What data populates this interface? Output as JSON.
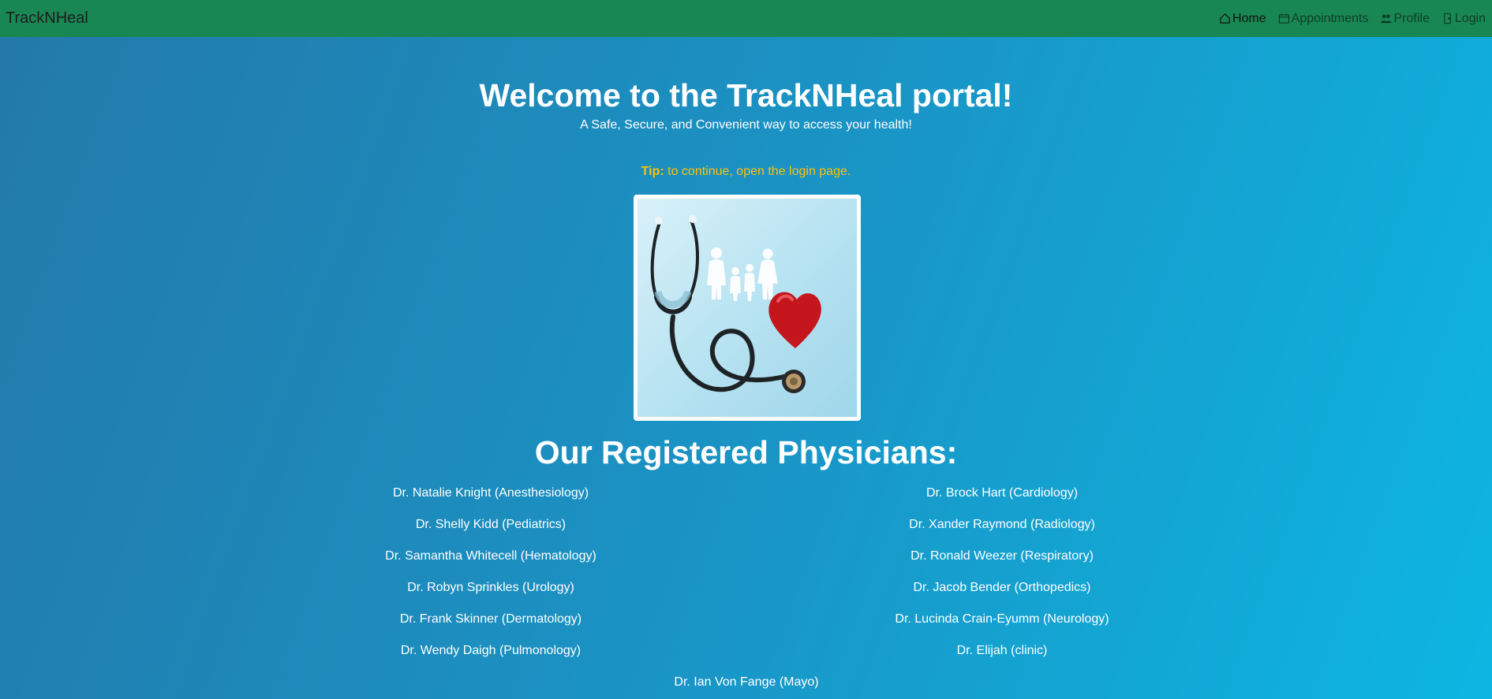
{
  "navbar": {
    "brand": "TrackNHeal",
    "items": [
      {
        "label": "Home",
        "icon": "home-icon"
      },
      {
        "label": "Appointments",
        "icon": "calendar-icon"
      },
      {
        "label": "Profile",
        "icon": "people-icon"
      },
      {
        "label": "Login",
        "icon": "door-icon"
      }
    ]
  },
  "hero": {
    "title": "Welcome to the TrackNHeal portal!",
    "subtitle": "A Safe, Secure, and Convenient way to access your health!",
    "tip_label": "Tip:",
    "tip_text": " to continue, open the login page."
  },
  "physicians": {
    "title": "Our Registered Physicians:",
    "left": [
      "Dr. Natalie Knight (Anesthesiology)",
      "Dr. Shelly Kidd (Pediatrics)",
      "Dr. Samantha Whitecell (Hematology)",
      "Dr. Robyn Sprinkles (Urology)",
      "Dr. Frank Skinner (Dermatology)",
      "Dr. Wendy Daigh (Pulmonology)"
    ],
    "right": [
      "Dr. Brock Hart (Cardiology)",
      "Dr. Xander Raymond (Radiology)",
      "Dr. Ronald Weezer (Respiratory)",
      "Dr. Jacob Bender (Orthopedics)",
      "Dr. Lucinda Crain-Eyumm (Neurology)",
      "Dr. Elijah (clinic)"
    ],
    "last": "Dr. Ian Von Fange (Mayo)"
  },
  "colors": {
    "navbar": "#198754",
    "tip": "#ffc107"
  }
}
